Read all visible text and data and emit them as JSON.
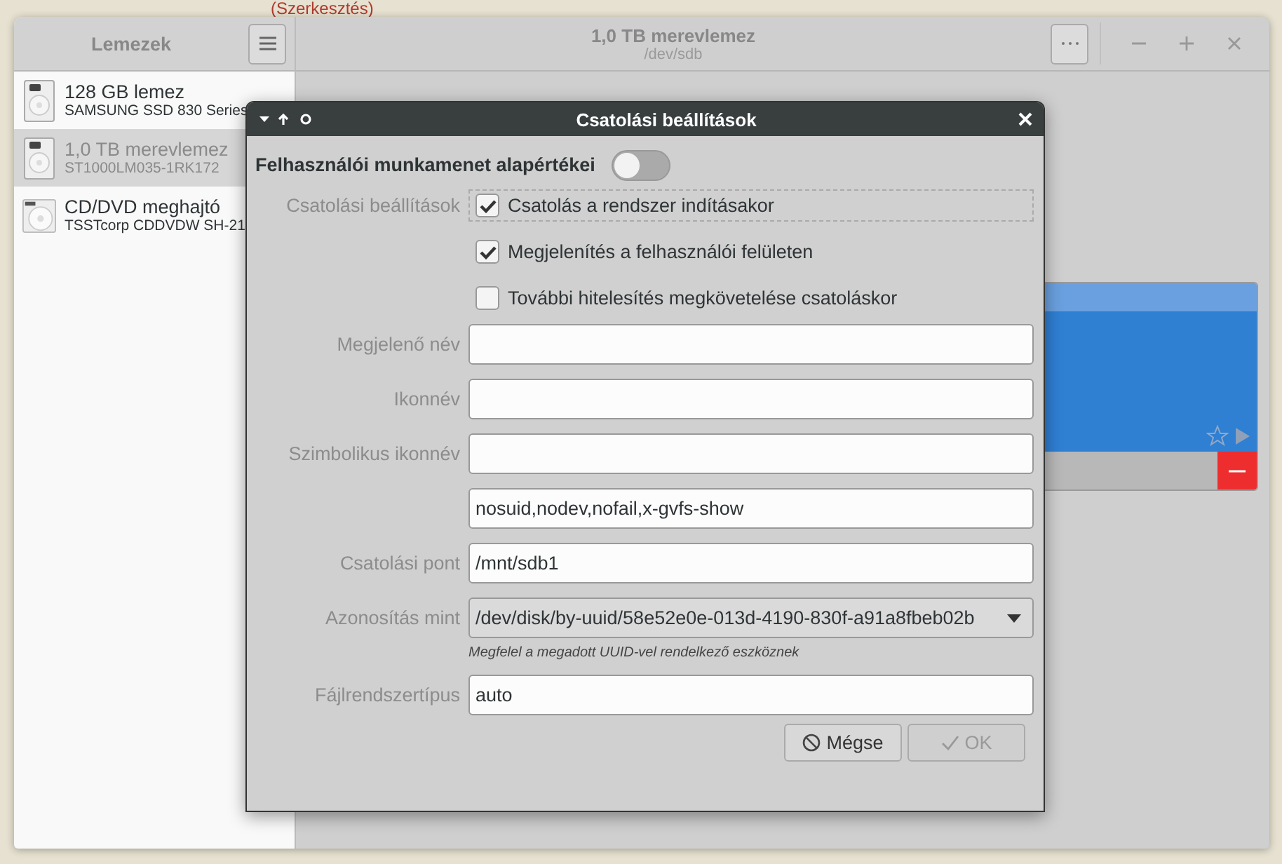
{
  "background": {
    "heading": "(Szerkesztés)"
  },
  "window": {
    "sidebar_title": "Lemezek",
    "title": "1,0 TB merevlemez",
    "subtitle": "/dev/sdb"
  },
  "disks": [
    {
      "name": "128 GB lemez",
      "model": "SAMSUNG SSD 830 Series",
      "kind": "drive",
      "selected": false
    },
    {
      "name": "1,0 TB merevlemez",
      "model": "ST1000LM035-1RK172",
      "kind": "drive",
      "selected": true
    },
    {
      "name": "CD/DVD meghajtó",
      "model": "TSSTcorp CDDVDW SH-21",
      "kind": "optical",
      "selected": false
    }
  ],
  "dialog": {
    "title": "Csatolási beállítások",
    "session_defaults": {
      "label": "Felhasználói munkamenet alapértékei",
      "on": false
    },
    "rows": [
      {
        "kind": "checkbox",
        "label": "Csatolási beállítások",
        "text": "Csatolás a rendszer indításakor",
        "checked": true,
        "focused": true
      },
      {
        "kind": "checkbox",
        "text": "Megjelenítés a felhasználói felületen",
        "checked": true,
        "focused": false
      },
      {
        "kind": "checkbox",
        "text": "További hitelesítés megkövetelése csatoláskor",
        "checked": false,
        "focused": false
      },
      {
        "kind": "field",
        "label": "Megjelenő név"
      },
      {
        "kind": "field",
        "label": "Ikonnév"
      },
      {
        "kind": "field",
        "label": "Szimbolikus ikonnév"
      },
      {
        "kind": "field",
        "value": "nosuid,nodev,nofail,x-gvfs-show"
      },
      {
        "kind": "field",
        "label": "Csatolási pont",
        "value": "/mnt/sdb1"
      },
      {
        "kind": "dropdown",
        "label": "Azonosítás mint",
        "value": "/dev/disk/by-uuid/58e52e0e-013d-4190-830f-a91a8fbeb02b"
      },
      {
        "kind": "hint",
        "text": "Megfelel a megadott UUID-vel rendelkező eszköznek"
      },
      {
        "kind": "field",
        "label": "Fájlrendszertípus",
        "value": "auto"
      }
    ],
    "buttons": [
      {
        "label": "Mégse",
        "kind": "cancel",
        "disabled": false
      },
      {
        "label": "OK",
        "kind": "ok",
        "disabled": true
      }
    ]
  }
}
